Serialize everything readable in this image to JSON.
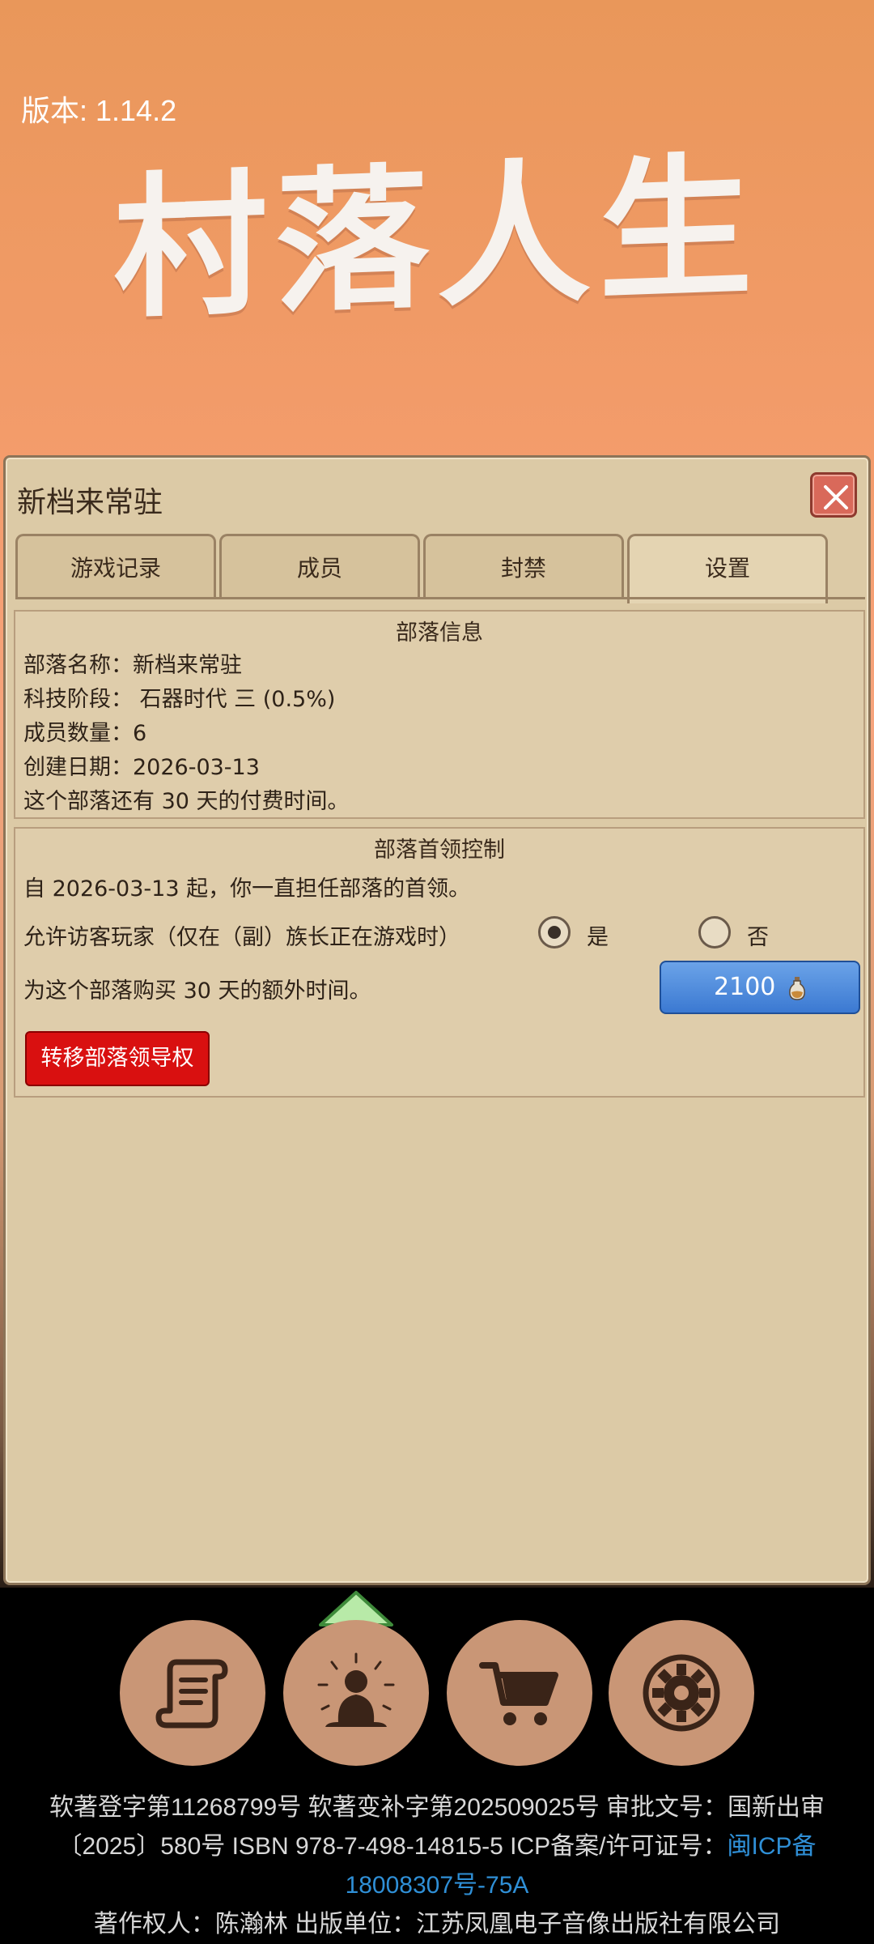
{
  "header": {
    "version": "版本: 1.14.2",
    "logo_text": "村落人生"
  },
  "dialog": {
    "title": "新档来常驻",
    "tabs": [
      {
        "label": "游戏记录",
        "active": false
      },
      {
        "label": "成员",
        "active": false
      },
      {
        "label": "封禁",
        "active": false
      },
      {
        "label": "设置",
        "active": true
      }
    ],
    "tribe_info": {
      "title": "部落信息",
      "lines": [
        "部落名称：新档来常驻",
        "科技阶段： 石器时代 三 (0.5%)",
        "成员数量：6",
        "创建日期：2026-03-13",
        "这个部落还有 30 天的付费时间。"
      ]
    },
    "leader_control": {
      "title": "部落首领控制",
      "leader_since": "自 2026-03-13 起，你一直担任部落的首领。",
      "allow_visitors_label": "允许访客玩家（仅在（副）族长正在游戏时）",
      "option_yes": "是",
      "option_no": "否",
      "selected": "yes",
      "buy_time_text": "为这个部落购买 30 天的额外时间。",
      "buy_price": "2100",
      "transfer_button": "转移部落领导权"
    }
  },
  "bottom_nav": {
    "items": [
      "scroll-icon",
      "meditation-icon",
      "cart-icon",
      "gear-icon"
    ]
  },
  "footer": {
    "line1": "软著登字第11268799号 软著变补字第202509025号 审批文号：国新出审",
    "line2_prefix": "〔2025〕580号 ISBN 978-7-498-14815-5 ICP备案/许可证号：",
    "line2_link": "闽ICP备",
    "line3_link": "18008307号-75A",
    "line4": "著作权人：陈瀚林 出版单位：江苏凤凰电子音像出版社有限公司"
  },
  "colors": {
    "accent_blue": "#3b79d2",
    "danger_red": "#d91010",
    "panel": "#dccaa6"
  }
}
